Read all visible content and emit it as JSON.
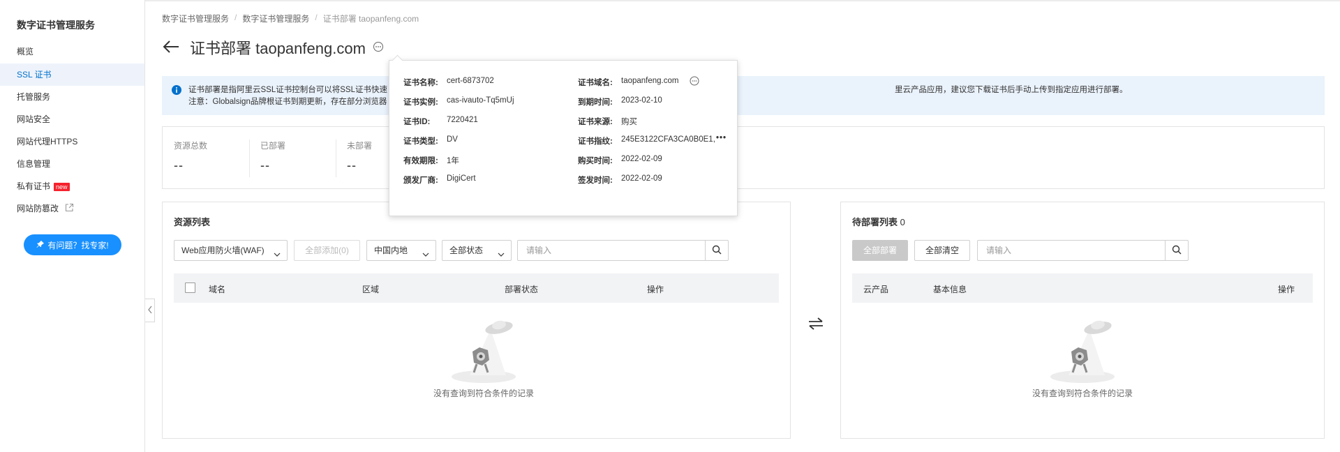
{
  "sidebar": {
    "title": "数字证书管理服务",
    "items": [
      {
        "label": "概览"
      },
      {
        "label": "SSL 证书",
        "active": true
      },
      {
        "label": "托管服务"
      },
      {
        "label": "网站安全"
      },
      {
        "label": "网站代理HTTPS"
      },
      {
        "label": "信息管理"
      },
      {
        "label": "私有证书",
        "badge": "new"
      },
      {
        "label": "网站防篡改",
        "icon": "external-link-icon"
      }
    ],
    "help_button": "有问题？找专家!"
  },
  "breadcrumb": [
    "数字证书管理服务",
    "数字证书管理服务",
    "证书部署 taopanfeng.com"
  ],
  "page_title": "证书部署 taopanfeng.com",
  "notice": {
    "line1": "证书部署是指阿里云SSL证书控制台可以将SSL证书快速",
    "line1_tail": "里云产品应用，建议您下载证书后手动上传到指定应用进行部署。",
    "line2": "注意：Globalsign品牌根证书到期更新，存在部分浏览器"
  },
  "stats": [
    {
      "label": "资源总数",
      "value": "--"
    },
    {
      "label": "已部署",
      "value": "--"
    },
    {
      "label": "未部署",
      "value": "--"
    }
  ],
  "resource_panel": {
    "title": "资源列表",
    "product_select": "Web应用防火墙(WAF)",
    "add_all": "全部添加(0)",
    "region_select": "中国内地",
    "status_select": "全部状态",
    "search_placeholder": "请输入",
    "columns": [
      "域名",
      "区域",
      "部署状态",
      "操作"
    ],
    "empty_text": "没有查询到符合条件的记录"
  },
  "pending_panel": {
    "title": "待部署列表",
    "count": "0",
    "deploy_all": "全部部署",
    "clear_all": "全部清空",
    "search_placeholder": "请输入",
    "columns": [
      "云产品",
      "基本信息",
      "操作"
    ],
    "empty_text": "没有查询到符合条件的记录"
  },
  "popover": {
    "left": [
      {
        "k": "证书名称:",
        "v": "cert-6873702"
      },
      {
        "k": "证书实例:",
        "v": "cas-ivauto-Tq5mUj"
      },
      {
        "k": "证书ID:",
        "v": "7220421"
      },
      {
        "k": "证书类型:",
        "v": "DV"
      },
      {
        "k": "有效期限:",
        "v": "1年"
      },
      {
        "k": "颁发厂商:",
        "v": "DigiCert"
      }
    ],
    "right": [
      {
        "k": "证书域名:",
        "v": "taopanfeng.com"
      },
      {
        "k": "到期时间:",
        "v": "2023-02-10"
      },
      {
        "k": "证书来源:",
        "v": "购买"
      },
      {
        "k": "证书指纹:",
        "v": "245E3122CFA3CA0B0E1,"
      },
      {
        "k": "购买时间:",
        "v": "2022-02-09"
      },
      {
        "k": "签发时间:",
        "v": "2022-02-09"
      }
    ]
  },
  "colors": {
    "accent": "#ff6a00",
    "primary": "#1890ff",
    "link": "#0070cc",
    "notice_bg": "#eaf2fb"
  }
}
